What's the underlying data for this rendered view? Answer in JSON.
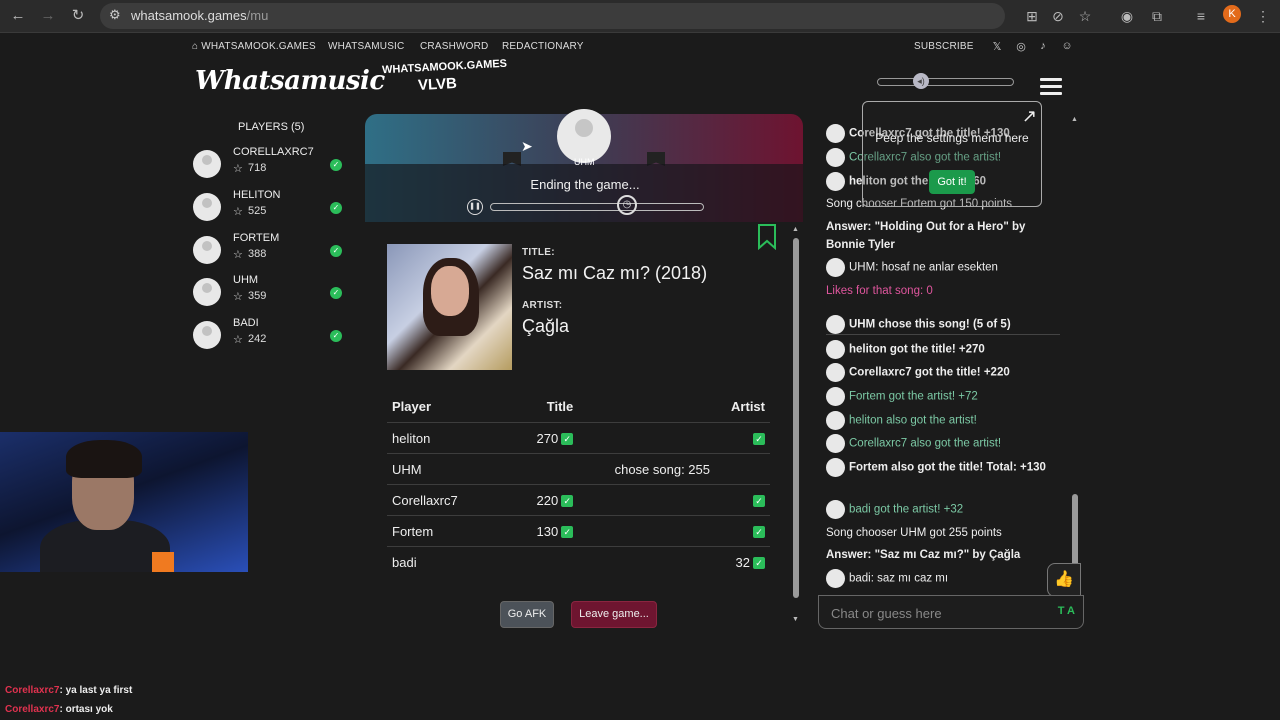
{
  "browser": {
    "url_host": "whatsamook.games",
    "url_path": "/mu",
    "profile_initial": "K"
  },
  "nav": {
    "home": "WHATSAMOOK.GAMES",
    "links": [
      "WHATSAMUSIC",
      "CRASHWORD",
      "REDACTIONARY"
    ],
    "subscribe": "SUBSCRIBE"
  },
  "logo": "Whatsamusic",
  "room": {
    "site": "WHATSAMOOK.GAMES",
    "code": "VLVB"
  },
  "players": {
    "title": "PLAYERS (5)",
    "list": [
      {
        "name": "CORELLAXRC7",
        "score": "718"
      },
      {
        "name": "HELITON",
        "score": "525"
      },
      {
        "name": "FORTEM",
        "score": "388"
      },
      {
        "name": "UHM",
        "score": "359"
      },
      {
        "name": "BADI",
        "score": "242"
      }
    ]
  },
  "now_playing": {
    "chooser": "UHM",
    "status": "Ending the game...",
    "title_label": "TITLE:",
    "title": "Saz mı Caz mı? (2018)",
    "artist_label": "ARTIST:",
    "artist": "Çağla"
  },
  "results": {
    "headers": {
      "player": "Player",
      "title": "Title",
      "artist": "Artist"
    },
    "rows": [
      {
        "player": "heliton",
        "title": "270",
        "title_check": true,
        "artist_check": true
      },
      {
        "player": "UHM",
        "title": "chose song: 255",
        "title_check": false,
        "artist_check": false
      },
      {
        "player": "Corellaxrc7",
        "title": "220",
        "title_check": true,
        "artist_check": true
      },
      {
        "player": "Fortem",
        "title": "130",
        "title_check": true,
        "artist_check": true
      },
      {
        "player": "badi",
        "title": "",
        "title_check": false,
        "artist": "32",
        "artist_check": true
      }
    ]
  },
  "buttons": {
    "afk": "Go AFK",
    "leave": "Leave game..."
  },
  "chat": {
    "m1": "Corellaxrc7 got the title! +130",
    "m2": "Corellaxrc7 also got the artist!",
    "m3": "heliton got the artist! +60",
    "m4": "Song chooser Fortem got 150 points",
    "m5": "Answer: \"Holding Out for a Hero\" by Bonnie Tyler",
    "m6": "UHM: hosaf ne anlar esekten",
    "m7": "Likes for that song: 0",
    "m8": "UHM chose this song! (5 of 5)",
    "m9": "heliton got the title! +270",
    "m10": "Corellaxrc7 got the title! +220",
    "m11": "Fortem got the artist! +72",
    "m12": "heliton also got the artist!",
    "m13": "Corellaxrc7 also got the artist!",
    "m14": "Fortem also got the title! Total: +130",
    "m15": "badi got the artist! +32",
    "m16": "Song chooser UHM got 255 points",
    "m17": "Answer: \"Saz mı Caz mı?\" by Çağla",
    "m18": "badi: saz mı caz mı",
    "placeholder": "Chat or guess here",
    "text_toggle": "T A"
  },
  "tooltip": {
    "text": "Peep the settings menu here",
    "button": "Got it!"
  },
  "stream_chat": [
    {
      "user": "Corellaxrc7",
      "text": ": ya last ya first"
    },
    {
      "user": "Corellaxrc7",
      "text": ": ortası yok"
    }
  ]
}
